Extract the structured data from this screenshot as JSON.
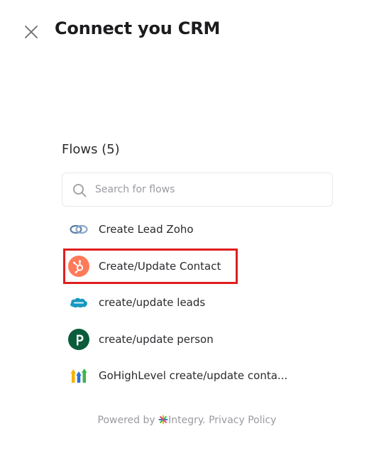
{
  "header": {
    "title": "Connect you CRM"
  },
  "flows": {
    "heading": "Flows (5)",
    "search_placeholder": "Search for flows",
    "items": [
      {
        "label": "Create Lead Zoho",
        "logo": "zoho-link-icon"
      },
      {
        "label": "Create/Update Contact",
        "logo": "hubspot-icon",
        "highlighted": true
      },
      {
        "label": "create/update leads",
        "logo": "salesforce-icon"
      },
      {
        "label": "create/update person",
        "logo": "pipedrive-icon"
      },
      {
        "label": "GoHighLevel create/update conta...",
        "logo": "gohighlevel-icon"
      }
    ]
  },
  "footer": {
    "powered_by": "Powered by",
    "brand": "Integry.",
    "privacy": "Privacy Policy"
  },
  "colors": {
    "highlight": "#e01e1e",
    "hubspot": "#ff7a59",
    "salesforce": "#1798c1",
    "pipedrive": "#0a5c3b",
    "muted_text": "#9a9aa2"
  }
}
